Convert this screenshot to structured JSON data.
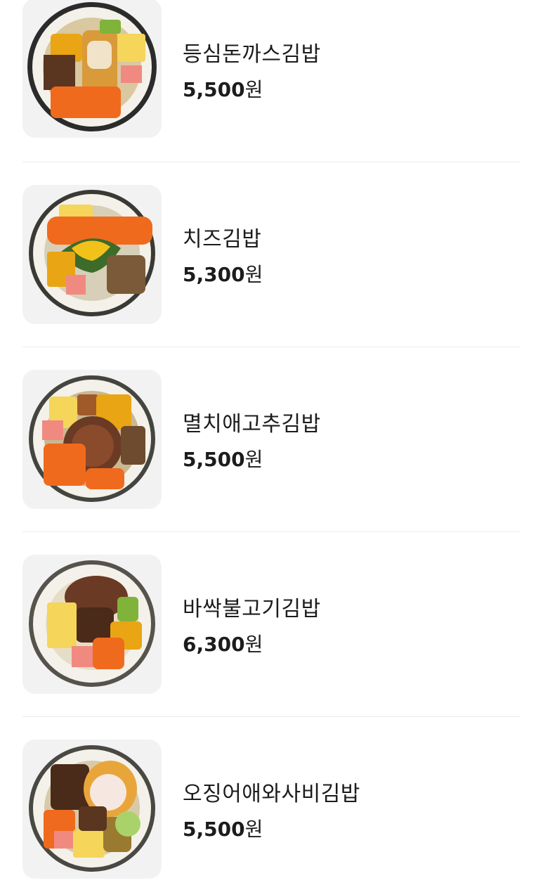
{
  "menu": {
    "items": [
      {
        "name": "등심돈까스김밥",
        "price": "5,500",
        "unit": "원",
        "image": "tonkatsu-kimbap-photo"
      },
      {
        "name": "치즈김밥",
        "price": "5,300",
        "unit": "원",
        "image": "cheese-kimbap-photo"
      },
      {
        "name": "멸치애고추김밥",
        "price": "5,500",
        "unit": "원",
        "image": "anchovy-pepper-kimbap-photo"
      },
      {
        "name": "바싹불고기김밥",
        "price": "6,300",
        "unit": "원",
        "image": "bulgogi-kimbap-photo"
      },
      {
        "name": "오징어애와사비김밥",
        "price": "5,500",
        "unit": "원",
        "image": "squid-wasabi-kimbap-photo"
      }
    ]
  },
  "colors": {
    "text": "#1c1c1c",
    "divider": "#ebebeb",
    "thumb_bg": "#f2f2f2",
    "seaweed": "#2b2b2b",
    "rice": "#f4f1ea",
    "carrot": "#f06a1e",
    "egg": "#f5d55a",
    "pickle": "#e9a514",
    "ham": "#f08a80",
    "beef": "#5a3520",
    "cucumber": "#7fb33a"
  }
}
